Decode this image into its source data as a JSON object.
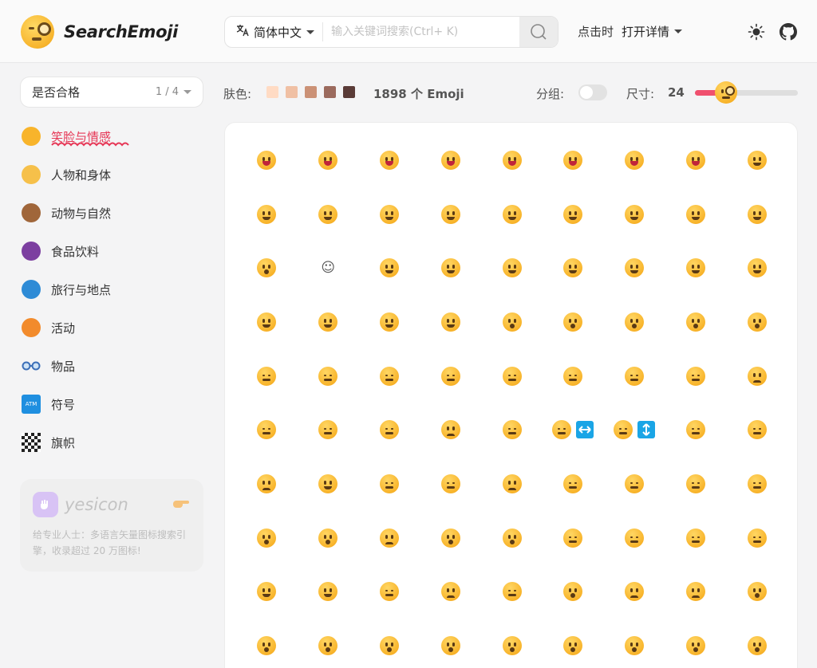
{
  "app": {
    "logo_text": "SearchEmoji"
  },
  "header": {
    "language": "简体中文",
    "search_placeholder": "输入关键词搜索(Ctrl+ K)",
    "click_mode_label": "点击时",
    "click_mode_value": "打开详情"
  },
  "sidebar": {
    "group_select": {
      "label": "是否合格",
      "page": "1 / 4"
    },
    "categories": [
      {
        "label": "笑脸与情感",
        "icon": "grinning-face-icon",
        "active": true,
        "color": "#f8b42b"
      },
      {
        "label": "人物和身体",
        "icon": "waving-hand-icon",
        "active": false,
        "color": "#f6c04a"
      },
      {
        "label": "动物与自然",
        "icon": "monkey-face-icon",
        "active": false,
        "color": "#a0663a"
      },
      {
        "label": "食品饮料",
        "icon": "grapes-icon",
        "active": false,
        "color": "#7c3fa0"
      },
      {
        "label": "旅行与地点",
        "icon": "globe-icon",
        "active": false,
        "color": "#2e8bd6"
      },
      {
        "label": "活动",
        "icon": "jack-o-lantern-icon",
        "active": false,
        "color": "#f28b2c"
      },
      {
        "label": "物品",
        "icon": "glasses-icon",
        "active": false,
        "color": "#3c6fb8"
      },
      {
        "label": "符号",
        "icon": "atm-sign-icon",
        "active": false,
        "color": "#1f8fe0"
      },
      {
        "label": "旗帜",
        "icon": "checkered-flag-icon",
        "active": false,
        "color": "#222222"
      }
    ],
    "ad": {
      "name": "yesicon",
      "description": "给专业人士：多语言矢量图标搜索引擎，收录超过 20 万图标!"
    }
  },
  "toolbar": {
    "skin_label": "肤色:",
    "skin_tones": [
      "#ffdbc4",
      "#f0c0a4",
      "#cb9176",
      "#9b6a5d",
      "#5a3b37"
    ],
    "count_text": "1898 个 Emoji",
    "group_label": "分组:",
    "group_enabled": false,
    "size_label": "尺寸:",
    "size_value": "24",
    "size_fraction": 0.3
  },
  "colors": {
    "accent": "#e63756",
    "slider": "#f0506e"
  },
  "grid": {
    "emojis": [
      "laugh",
      "laugh",
      "laugh",
      "laugh",
      "laugh",
      "laugh",
      "laugh",
      "laugh",
      "smile",
      "smile",
      "smile",
      "smile",
      "smile",
      "smile",
      "smile",
      "smile",
      "smile",
      "smile",
      "wow",
      "text-smile",
      "smile",
      "smile",
      "smile",
      "smile",
      "smile",
      "smile",
      "smile",
      "smile",
      "smile",
      "smile",
      "smile",
      "wow",
      "wow",
      "wow",
      "wow",
      "wow",
      "flat",
      "flat",
      "flat",
      "flat",
      "flat",
      "flat",
      "flat",
      "flat",
      "sad",
      "flat",
      "flat",
      "flat",
      "sad",
      "flat",
      "arrows-h",
      "arrows-v",
      "flat",
      "flat",
      "sad",
      "smile",
      "flat",
      "flat",
      "sad",
      "flat",
      "flat",
      "flat",
      "flat",
      "wow",
      "wow",
      "sad",
      "wow",
      "wow",
      "flat",
      "flat",
      "flat",
      "flat",
      "smile",
      "smile",
      "flat",
      "sad",
      "flat",
      "wow",
      "sad",
      "sad",
      "wow",
      "wow",
      "wow",
      "wow",
      "wow",
      "wow",
      "wow",
      "wow",
      "wow",
      "wow"
    ],
    "text_glyph": "☺"
  }
}
